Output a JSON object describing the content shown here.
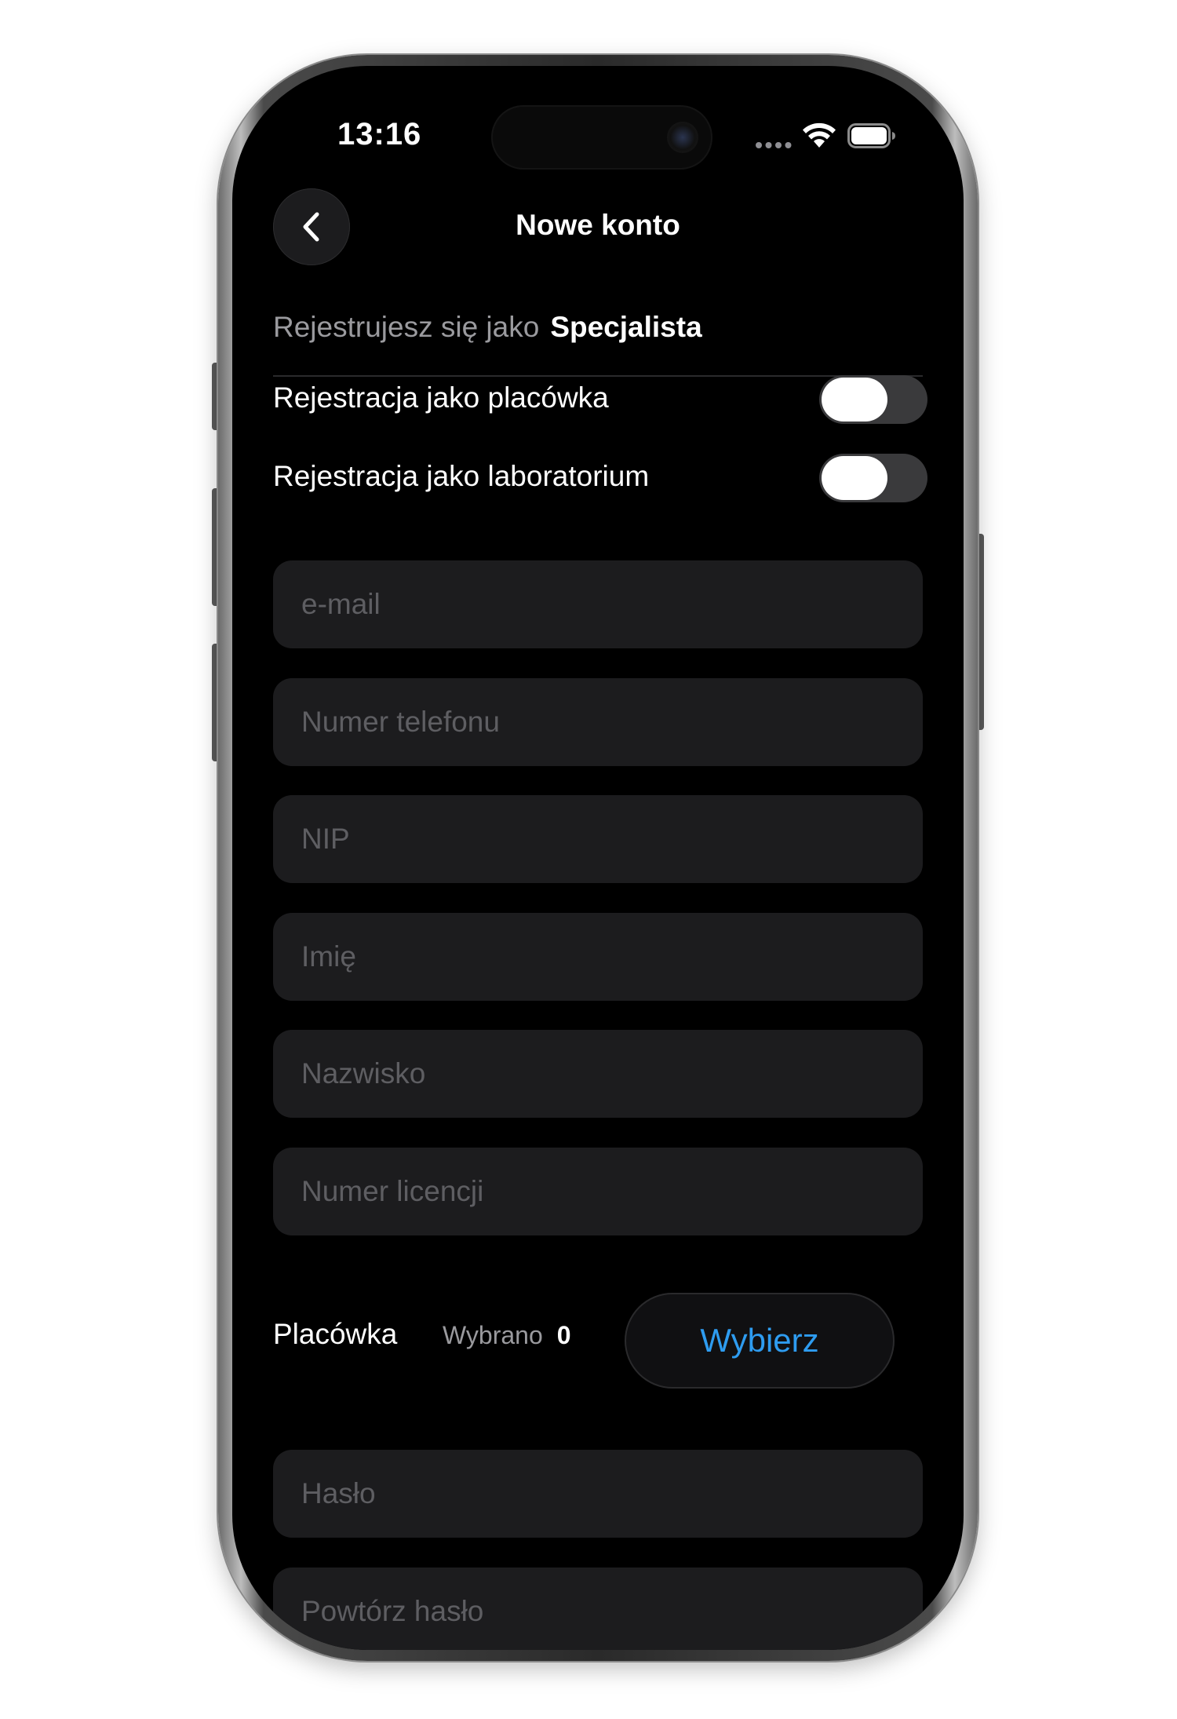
{
  "status_bar": {
    "time": "13:16"
  },
  "header": {
    "title": "Nowe konto",
    "back_icon": "chevron-left-icon"
  },
  "role": {
    "prefix": "Rejestrujesz się jako",
    "value": "Specjalista"
  },
  "toggles": [
    {
      "label": "Rejestracja jako placówka",
      "on": false
    },
    {
      "label": "Rejestracja jako laboratorium",
      "on": false
    }
  ],
  "fields": {
    "email": {
      "placeholder": "e-mail",
      "value": ""
    },
    "phone": {
      "placeholder": "Numer telefonu",
      "value": ""
    },
    "nip": {
      "placeholder": "NIP",
      "value": ""
    },
    "first_name": {
      "placeholder": "Imię",
      "value": ""
    },
    "last_name": {
      "placeholder": "Nazwisko",
      "value": ""
    },
    "license": {
      "placeholder": "Numer licencji",
      "value": ""
    },
    "password": {
      "placeholder": "Hasło",
      "value": ""
    },
    "password_repeat": {
      "placeholder": "Powtórz hasło",
      "value": ""
    }
  },
  "facility": {
    "label": "Placówka",
    "selected_label": "Wybrano",
    "selected_count": "0",
    "choose_label": "Wybierz"
  },
  "colors": {
    "background": "#000000",
    "field_background": "#1c1c1e",
    "accent": "#2e9cf0",
    "placeholder": "#5e5e62",
    "secondary_text": "#9a9a9e"
  }
}
